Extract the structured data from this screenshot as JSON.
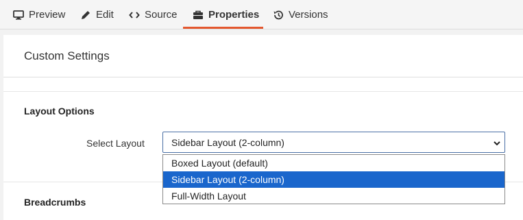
{
  "tabs": [
    {
      "label": "Preview",
      "icon": "monitor-icon"
    },
    {
      "label": "Edit",
      "icon": "pencil-icon"
    },
    {
      "label": "Source",
      "icon": "code-icon"
    },
    {
      "label": "Properties",
      "icon": "toolbox-icon",
      "active": true
    },
    {
      "label": "Versions",
      "icon": "history-icon"
    }
  ],
  "colors": {
    "accent": "#e4572e",
    "selection": "#1a66cc",
    "select_border": "#4a6fa5"
  },
  "panel": {
    "title": "Custom Settings"
  },
  "layout_section": {
    "title": "Layout Options",
    "field_label": "Select Layout",
    "selected_value": "Sidebar Layout (2-column)",
    "options": [
      {
        "label": "Boxed Layout (default)",
        "selected": false
      },
      {
        "label": "Sidebar Layout (2-column)",
        "selected": true
      },
      {
        "label": "Full-Width Layout",
        "selected": false
      }
    ]
  },
  "breadcrumbs_section": {
    "title": "Breadcrumbs"
  }
}
